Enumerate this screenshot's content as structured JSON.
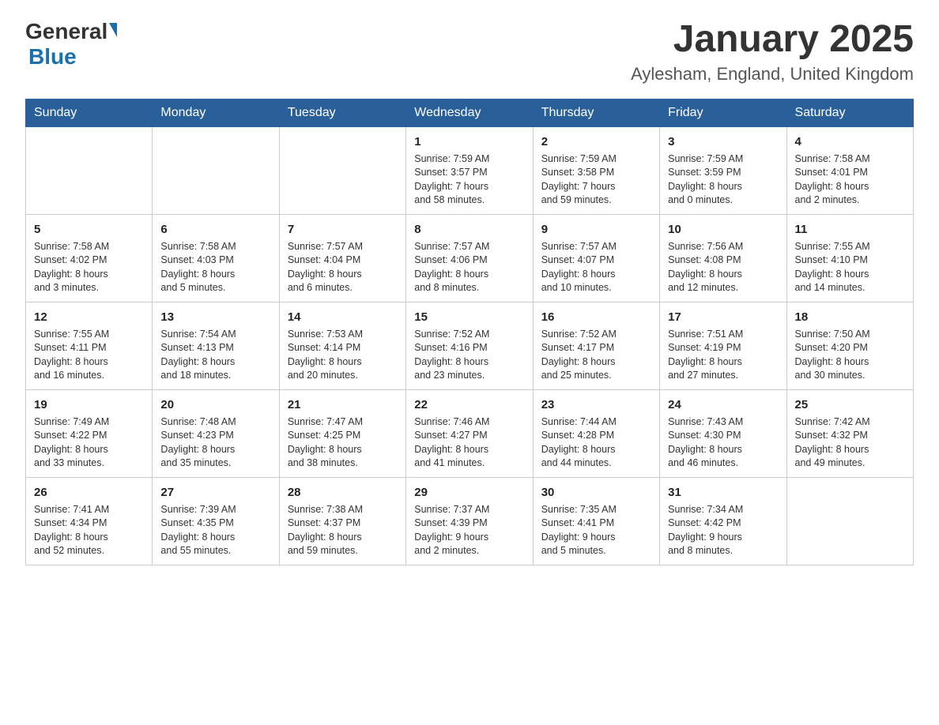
{
  "logo": {
    "general": "General",
    "blue": "Blue"
  },
  "header": {
    "month": "January 2025",
    "location": "Aylesham, England, United Kingdom"
  },
  "weekdays": [
    "Sunday",
    "Monday",
    "Tuesday",
    "Wednesday",
    "Thursday",
    "Friday",
    "Saturday"
  ],
  "weeks": [
    [
      {
        "day": "",
        "info": ""
      },
      {
        "day": "",
        "info": ""
      },
      {
        "day": "",
        "info": ""
      },
      {
        "day": "1",
        "info": "Sunrise: 7:59 AM\nSunset: 3:57 PM\nDaylight: 7 hours\nand 58 minutes."
      },
      {
        "day": "2",
        "info": "Sunrise: 7:59 AM\nSunset: 3:58 PM\nDaylight: 7 hours\nand 59 minutes."
      },
      {
        "day": "3",
        "info": "Sunrise: 7:59 AM\nSunset: 3:59 PM\nDaylight: 8 hours\nand 0 minutes."
      },
      {
        "day": "4",
        "info": "Sunrise: 7:58 AM\nSunset: 4:01 PM\nDaylight: 8 hours\nand 2 minutes."
      }
    ],
    [
      {
        "day": "5",
        "info": "Sunrise: 7:58 AM\nSunset: 4:02 PM\nDaylight: 8 hours\nand 3 minutes."
      },
      {
        "day": "6",
        "info": "Sunrise: 7:58 AM\nSunset: 4:03 PM\nDaylight: 8 hours\nand 5 minutes."
      },
      {
        "day": "7",
        "info": "Sunrise: 7:57 AM\nSunset: 4:04 PM\nDaylight: 8 hours\nand 6 minutes."
      },
      {
        "day": "8",
        "info": "Sunrise: 7:57 AM\nSunset: 4:06 PM\nDaylight: 8 hours\nand 8 minutes."
      },
      {
        "day": "9",
        "info": "Sunrise: 7:57 AM\nSunset: 4:07 PM\nDaylight: 8 hours\nand 10 minutes."
      },
      {
        "day": "10",
        "info": "Sunrise: 7:56 AM\nSunset: 4:08 PM\nDaylight: 8 hours\nand 12 minutes."
      },
      {
        "day": "11",
        "info": "Sunrise: 7:55 AM\nSunset: 4:10 PM\nDaylight: 8 hours\nand 14 minutes."
      }
    ],
    [
      {
        "day": "12",
        "info": "Sunrise: 7:55 AM\nSunset: 4:11 PM\nDaylight: 8 hours\nand 16 minutes."
      },
      {
        "day": "13",
        "info": "Sunrise: 7:54 AM\nSunset: 4:13 PM\nDaylight: 8 hours\nand 18 minutes."
      },
      {
        "day": "14",
        "info": "Sunrise: 7:53 AM\nSunset: 4:14 PM\nDaylight: 8 hours\nand 20 minutes."
      },
      {
        "day": "15",
        "info": "Sunrise: 7:52 AM\nSunset: 4:16 PM\nDaylight: 8 hours\nand 23 minutes."
      },
      {
        "day": "16",
        "info": "Sunrise: 7:52 AM\nSunset: 4:17 PM\nDaylight: 8 hours\nand 25 minutes."
      },
      {
        "day": "17",
        "info": "Sunrise: 7:51 AM\nSunset: 4:19 PM\nDaylight: 8 hours\nand 27 minutes."
      },
      {
        "day": "18",
        "info": "Sunrise: 7:50 AM\nSunset: 4:20 PM\nDaylight: 8 hours\nand 30 minutes."
      }
    ],
    [
      {
        "day": "19",
        "info": "Sunrise: 7:49 AM\nSunset: 4:22 PM\nDaylight: 8 hours\nand 33 minutes."
      },
      {
        "day": "20",
        "info": "Sunrise: 7:48 AM\nSunset: 4:23 PM\nDaylight: 8 hours\nand 35 minutes."
      },
      {
        "day": "21",
        "info": "Sunrise: 7:47 AM\nSunset: 4:25 PM\nDaylight: 8 hours\nand 38 minutes."
      },
      {
        "day": "22",
        "info": "Sunrise: 7:46 AM\nSunset: 4:27 PM\nDaylight: 8 hours\nand 41 minutes."
      },
      {
        "day": "23",
        "info": "Sunrise: 7:44 AM\nSunset: 4:28 PM\nDaylight: 8 hours\nand 44 minutes."
      },
      {
        "day": "24",
        "info": "Sunrise: 7:43 AM\nSunset: 4:30 PM\nDaylight: 8 hours\nand 46 minutes."
      },
      {
        "day": "25",
        "info": "Sunrise: 7:42 AM\nSunset: 4:32 PM\nDaylight: 8 hours\nand 49 minutes."
      }
    ],
    [
      {
        "day": "26",
        "info": "Sunrise: 7:41 AM\nSunset: 4:34 PM\nDaylight: 8 hours\nand 52 minutes."
      },
      {
        "day": "27",
        "info": "Sunrise: 7:39 AM\nSunset: 4:35 PM\nDaylight: 8 hours\nand 55 minutes."
      },
      {
        "day": "28",
        "info": "Sunrise: 7:38 AM\nSunset: 4:37 PM\nDaylight: 8 hours\nand 59 minutes."
      },
      {
        "day": "29",
        "info": "Sunrise: 7:37 AM\nSunset: 4:39 PM\nDaylight: 9 hours\nand 2 minutes."
      },
      {
        "day": "30",
        "info": "Sunrise: 7:35 AM\nSunset: 4:41 PM\nDaylight: 9 hours\nand 5 minutes."
      },
      {
        "day": "31",
        "info": "Sunrise: 7:34 AM\nSunset: 4:42 PM\nDaylight: 9 hours\nand 8 minutes."
      },
      {
        "day": "",
        "info": ""
      }
    ]
  ]
}
